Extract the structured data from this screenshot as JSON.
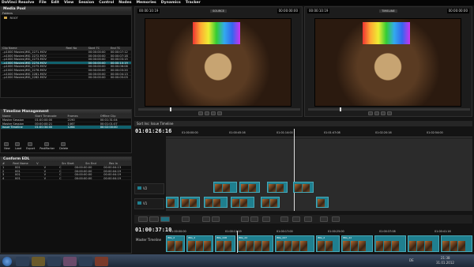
{
  "menu": [
    "DaVinci Resolve",
    "File",
    "Edit",
    "View",
    "Session",
    "Control",
    "Nodes",
    "Memories",
    "Dynamics",
    "Tracker"
  ],
  "media_pool": {
    "title": "Media Pool",
    "folders_header": "Folders",
    "root": "ROOT",
    "columns": [
      "Clip Name",
      "Reel No",
      "Start TC",
      "End TC"
    ],
    "rows": [
      [
        "..p1000 Movies\\IMG_2271.MOV",
        "",
        "00:00:00:00",
        "00:00:07:12"
      ],
      [
        "..p1000 Movies\\IMG_2272.MOV",
        "",
        "00:00:00:00",
        "00:00:07:18"
      ],
      [
        "..p1000 Movies\\IMG_2273.MOV",
        "",
        "00:00:00:00",
        "00:00:03:15"
      ],
      [
        "..p1000 Movies\\IMG_2274.MOV",
        "",
        "00:00:00:00",
        "00:00:10:19"
      ],
      [
        "..p1000 Movies\\IMG_2275.MOV",
        "",
        "00:00:00:00",
        "00:00:06:08"
      ],
      [
        "..p1000 Movies\\IMG_2276.MOV",
        "",
        "00:00:00:00",
        "00:00:03:20"
      ],
      [
        "..p1000 Movies\\IMG_2281.MOV",
        "",
        "00:00:00:00",
        "00:00:04:13"
      ],
      [
        "..p1000 Movies\\IMG_2282.MOV",
        "",
        "00:00:00:00",
        "00:00:05:03"
      ]
    ],
    "selected_index": 3
  },
  "timeline_mgmt": {
    "title": "Timeline Management",
    "columns": [
      "Name",
      "Start Timecode",
      "Frames",
      "Offline Clip"
    ],
    "rows": [
      [
        "Master Session",
        "01:00:00:00",
        "2190",
        "00:01:31:04"
      ],
      [
        "Master Session",
        "00:00:00:21",
        "1467",
        "00:01:01:07"
      ],
      [
        "Issue Timeline",
        "01:00:34:00",
        "1264",
        "00:02:00:00"
      ]
    ],
    "selected_index": 2,
    "actions": [
      "New",
      "Load",
      "Export",
      "PostMarker",
      "Delete"
    ]
  },
  "conform": {
    "title": "Conform EDL",
    "columns": [
      "#",
      "Reel Name",
      "V",
      "Src Start",
      "Src End",
      "Rec In"
    ],
    "rows": [
      [
        "1",
        "001",
        "V",
        "C",
        "00:00:00:00",
        "00:00:04:13"
      ],
      [
        "2",
        "001",
        "V",
        "C",
        "00:00:00:00",
        "00:00:04:19"
      ],
      [
        "3",
        "001",
        "V",
        "C",
        "00:00:00:00",
        "00:00:04:19"
      ],
      [
        "4",
        "001",
        "V",
        "C",
        "00:00:00:00",
        "00:00:04:19"
      ]
    ]
  },
  "source_viewer": {
    "label": "SOURCE",
    "tc_in": "00:00:10:19",
    "tc_out": "00:00:00:00"
  },
  "record_viewer": {
    "label": "TIMELINE",
    "tc_in": "00:00:10:19",
    "tc_out": "00:00:00:00"
  },
  "timeline": {
    "title": "Sort Ins: Issue Timeline",
    "current_tc": "01:01:26:16",
    "ruler": [
      "01:00:00:00",
      "01:00:45:16",
      "01:01:14:00",
      "01:01:47:08",
      "01:02:20:16",
      "01:02:54:00"
    ],
    "tracks": [
      "V2",
      "V1"
    ]
  },
  "mini": {
    "current_tc": "01:00:37:10",
    "track_label": "Master Timeline",
    "ruler": [
      "01:00:00:00",
      "01:00:11:19",
      "01:00:17:00",
      "01:00:25:00",
      "01:00:37:08",
      "01:00:41:16"
    ],
    "clips": [
      "IMG_2",
      "IMG_2",
      "IMG_228",
      "IMG_22",
      "IMG_227",
      "IMG_2",
      "IMG_22"
    ]
  },
  "taskbar": {
    "lang": "DE",
    "time": "21:38",
    "date": "31.01.2012"
  }
}
